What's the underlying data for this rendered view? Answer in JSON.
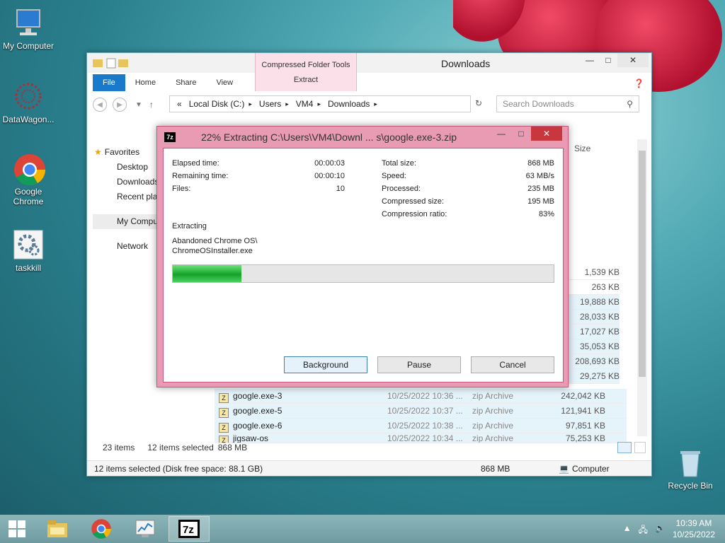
{
  "desktop": {
    "icons": [
      {
        "label": "My Computer"
      },
      {
        "label": "DataWagon..."
      },
      {
        "label": "Google Chrome"
      },
      {
        "label": "taskkill"
      },
      {
        "label": "Recycle Bin"
      }
    ]
  },
  "explorer": {
    "title": "Downloads",
    "context_group": "Compressed Folder Tools",
    "context_tab": "Extract",
    "tabs": [
      "File",
      "Home",
      "Share",
      "View"
    ],
    "address": [
      "«",
      "Local Disk (C:)",
      "Users",
      "VM4",
      "Downloads"
    ],
    "search_placeholder": "Search Downloads",
    "size_header": "Size",
    "nav": [
      "Favorites",
      "Desktop",
      "Downloads",
      "Recent places",
      "My Computer",
      "Network"
    ],
    "sizes": [
      "1,539 KB",
      "263 KB",
      "19,888 KB",
      "28,033 KB",
      "17,027 KB",
      "35,053 KB",
      "208,693 KB",
      "29,275 KB"
    ],
    "files": [
      {
        "name": "google.exe-3",
        "date": "10/25/2022 10:36 ...",
        "type": "zip Archive",
        "size": "242,042 KB"
      },
      {
        "name": "google.exe-5",
        "date": "10/25/2022 10:37 ...",
        "type": "zip Archive",
        "size": "121,941 KB"
      },
      {
        "name": "google.exe-6",
        "date": "10/25/2022 10:38 ...",
        "type": "zip Archive",
        "size": "97,851 KB"
      },
      {
        "name": "jigsaw-os",
        "date": "10/25/2022 10:34 ...",
        "type": "zip Archive",
        "size": "75,253 KB"
      }
    ],
    "status_count": "23 items",
    "status_selected": "12 items selected",
    "status_size": "868 MB",
    "statusbar_text": "12 items selected (Disk free space: 88.1 GB)",
    "statusbar_size": "868 MB",
    "statusbar_location": "Computer"
  },
  "dialog": {
    "title": "22% Extracting C:\\Users\\VM4\\Downl ... s\\google.exe-3.zip",
    "icon_text": "7z",
    "left": [
      {
        "label": "Elapsed time:",
        "value": "00:00:03"
      },
      {
        "label": "Remaining time:",
        "value": "00:00:10"
      },
      {
        "label": "Files:",
        "value": "10"
      }
    ],
    "right": [
      {
        "label": "Total size:",
        "value": "868 MB"
      },
      {
        "label": "Speed:",
        "value": "63 MB/s"
      },
      {
        "label": "Processed:",
        "value": "235 MB"
      },
      {
        "label": "Compressed size:",
        "value": "195 MB"
      },
      {
        "label": "Compression ratio:",
        "value": "83%"
      }
    ],
    "action_label": "Extracting",
    "current_file_line1": "Abandoned Chrome OS\\",
    "current_file_line2": "ChromeOSInstaller.exe",
    "progress": 0.18,
    "buttons": {
      "background": "Background",
      "pause": "Pause",
      "cancel": "Cancel"
    }
  },
  "taskbar": {
    "time": "10:39 AM",
    "date": "10/25/2022",
    "pinned": [
      "File Explorer",
      "Google Chrome",
      "Resource Monitor",
      "7-Zip"
    ]
  }
}
